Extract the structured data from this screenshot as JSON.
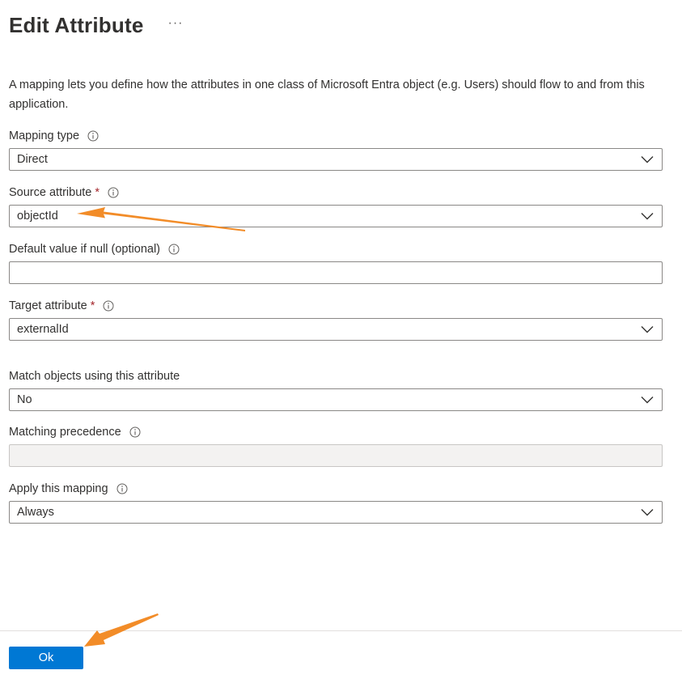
{
  "header": {
    "title": "Edit Attribute",
    "more_label": "···"
  },
  "description": "A mapping lets you define how the attributes in one class of Microsoft Entra object (e.g. Users) should flow to and from this application.",
  "fields": {
    "mapping_type": {
      "label": "Mapping type",
      "value": "Direct"
    },
    "source_attribute": {
      "label": "Source attribute",
      "required_mark": "*",
      "value": "objectId"
    },
    "default_value": {
      "label": "Default value if null (optional)",
      "value": ""
    },
    "target_attribute": {
      "label": "Target attribute",
      "required_mark": "*",
      "value": "externalId"
    },
    "match_objects": {
      "label": "Match objects using this attribute",
      "value": "No"
    },
    "matching_precedence": {
      "label": "Matching precedence",
      "value": ""
    },
    "apply_mapping": {
      "label": "Apply this mapping",
      "value": "Always"
    }
  },
  "footer": {
    "ok_label": "Ok"
  },
  "colors": {
    "primary": "#0078d4",
    "required": "#a4262c",
    "annotation_arrow": "#f28c28",
    "disabled_bg": "#f3f2f1"
  },
  "icons": [
    "more-icon",
    "info-icon",
    "chevron-down-icon",
    "annotation-arrow-icon"
  ]
}
